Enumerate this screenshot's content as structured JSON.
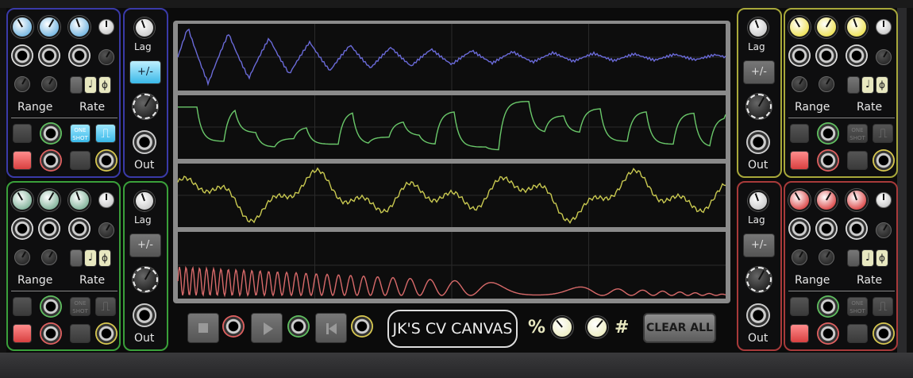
{
  "module": {
    "title": "JK'S CV CANVAS",
    "clear_label": "CLEAR ALL",
    "percent_symbol": "%",
    "hash_symbol": "#"
  },
  "labels": {
    "range": "Range",
    "rate": "Rate",
    "lag": "Lag",
    "out": "Out",
    "polarity": "+/-",
    "one_shot": "ONE SHOT",
    "sync": "♩",
    "phase": "ϕ",
    "square": "⎍"
  },
  "channels": [
    {
      "name": "blue",
      "color": "#3a3aa8",
      "knob": "#4aa0d8",
      "polarity_active": true,
      "one_shot_active": true,
      "square_active": true
    },
    {
      "name": "green",
      "color": "#3aa03a",
      "knob": "#5a9a7a",
      "polarity_active": false,
      "one_shot_active": false,
      "square_active": false
    },
    {
      "name": "yellow",
      "color": "#a8a83a",
      "knob": "#e8d820",
      "polarity_active": false,
      "one_shot_active": false,
      "square_active": false
    },
    {
      "name": "red",
      "color": "#a83a3a",
      "knob": "#d01010",
      "polarity_active": false,
      "one_shot_active": false,
      "square_active": false
    }
  ],
  "traces": {
    "colors": [
      "#6a6ad8",
      "#6ac86a",
      "#c8c850",
      "#d86a6a"
    ]
  }
}
